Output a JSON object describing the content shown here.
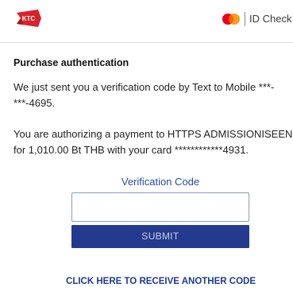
{
  "header": {
    "logo_text": "KTC",
    "id_check_label": "ID Check",
    "colors": {
      "ktc_red": "#d8232a",
      "mastercard_red": "#eb001b",
      "mastercard_yellow": "#f79e1b"
    }
  },
  "auth": {
    "title": "Purchase authentication",
    "sent_message_line1": "We just sent you a verification code by Text to Mobile ***-",
    "sent_message_line2": "***-4695.",
    "payment_message_line1": "You are authorizing a payment to HTTPS ADMISSIONISEENG",
    "payment_message_line2": "for 1,010.00 Bt THB with your card ************4931.",
    "code_label": "Verification Code",
    "code_value": "",
    "submit_label": "SUBMIT",
    "resend_label": "CLICK HERE TO RECEIVE ANOTHER CODE"
  },
  "colors": {
    "accent": "#243a8e",
    "link": "#1c3a8e"
  }
}
